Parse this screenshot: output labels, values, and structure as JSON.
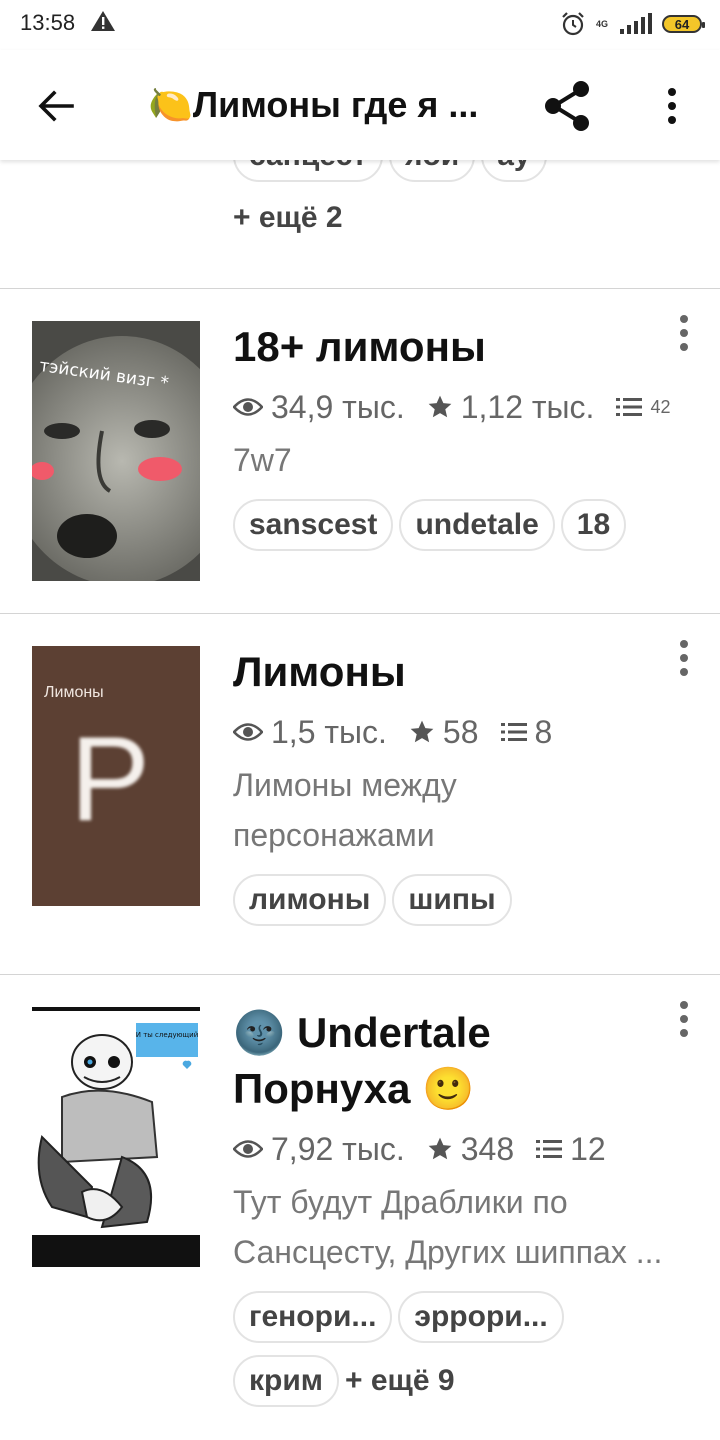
{
  "status": {
    "time": "13:58",
    "network": "4G",
    "battery": "64"
  },
  "header": {
    "title": "Лимоны где я ...",
    "title_emoji": "🍋"
  },
  "prev_card": {
    "tags": [
      "санцест",
      "яой",
      "ау"
    ],
    "more": "+ ещё 2"
  },
  "cards": [
    {
      "title": "18+ лимоны",
      "views": "34,9 тыс.",
      "likes": "1,12 тыс.",
      "parts": "42",
      "description": "7w7",
      "cover_text": "тэйский визг *",
      "tags": [
        "sanscest",
        "undetale",
        "18"
      ]
    },
    {
      "title": "Лимоны",
      "views": "1,5 тыс.",
      "likes": "58",
      "parts": "8",
      "description": "Лимоны между персонажами",
      "cover_text": "Лимоны",
      "cover_letter": "P",
      "tags": [
        "лимоны",
        "шипы"
      ]
    },
    {
      "title_line1": "🌚 Undertale",
      "title_line2": "Порнуха 🙂",
      "views": "7,92 тыс.",
      "likes": "348",
      "parts": "12",
      "description_line1": "Тут будут Драблики по",
      "description_line2": "Сансцесту, Других шиппах ...",
      "cover_text": "И ты следующий",
      "tags": [
        "генори...",
        "эррори...",
        "крим"
      ],
      "more": "+ ещё 9"
    }
  ],
  "colors": {
    "accent": "#f3c629",
    "cover2_bg": "#5c4033",
    "divider": "#d4d4d4"
  }
}
